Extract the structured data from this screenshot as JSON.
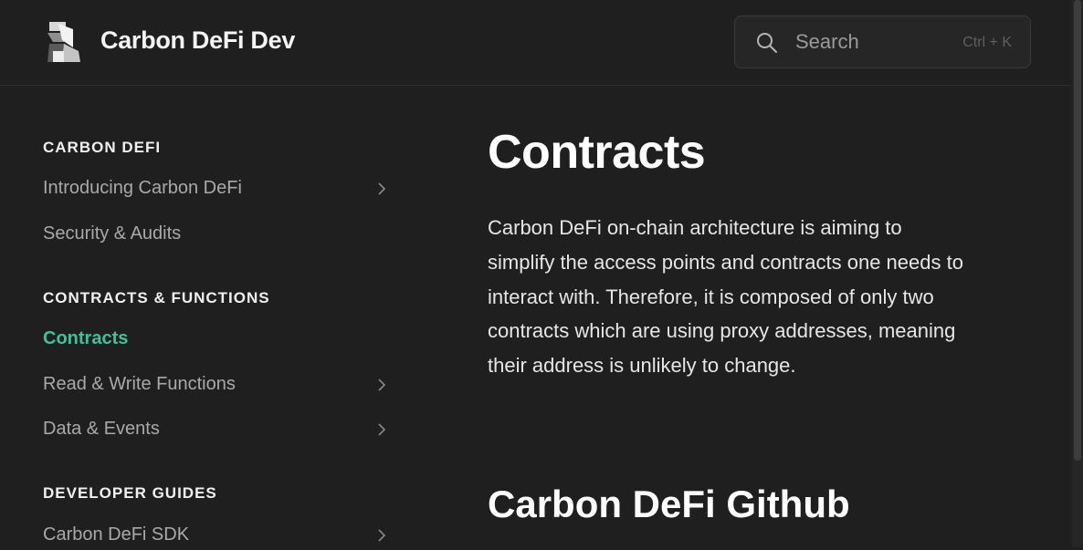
{
  "header": {
    "brand": "Carbon DeFi Dev",
    "logo_icon": "carbon-logo-icon",
    "search": {
      "placeholder": "Search",
      "shortcut": "Ctrl + K",
      "icon": "search-icon"
    }
  },
  "sidebar": {
    "sections": [
      {
        "title": "CARBON DEFI",
        "items": [
          {
            "label": "Introducing Carbon DeFi",
            "has_children": true
          },
          {
            "label": "Security & Audits",
            "has_children": false
          }
        ]
      },
      {
        "title": "CONTRACTS & FUNCTIONS",
        "items": [
          {
            "label": "Contracts",
            "has_children": false,
            "active": true
          },
          {
            "label": "Read & Write Functions",
            "has_children": true
          },
          {
            "label": "Data & Events",
            "has_children": true
          }
        ]
      },
      {
        "title": "DEVELOPER GUIDES",
        "items": [
          {
            "label": "Carbon DeFi SDK",
            "has_children": true
          }
        ]
      }
    ]
  },
  "main": {
    "title": "Contracts",
    "intro": "Carbon DeFi on-chain architecture is aiming to simplify the access points and contracts one needs to interact with. Therefore, it is composed of only two contracts which are using proxy addresses, meaning their address is unlikely to change.",
    "section_heading": "Carbon DeFi Github"
  },
  "colors": {
    "background": "#1f1f1f",
    "accent": "#3cc39a",
    "text": "#e6e6e6",
    "muted": "#a9a9a9"
  }
}
